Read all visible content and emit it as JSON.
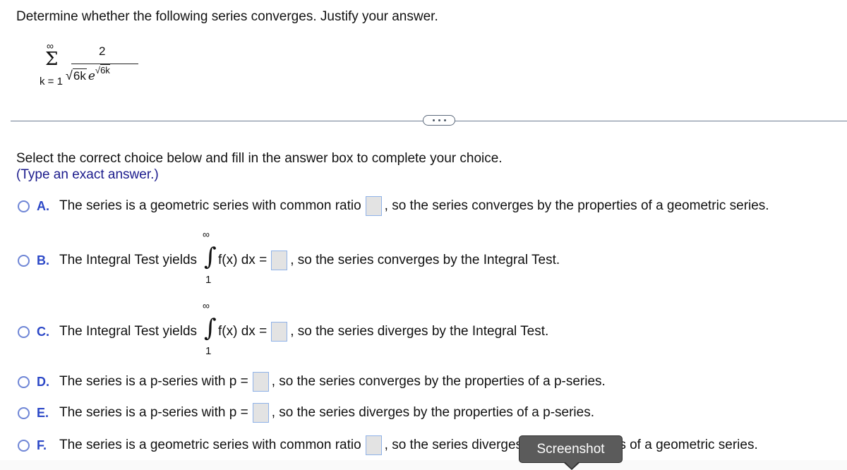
{
  "question": {
    "prompt": "Determine whether the following series converges. Justify your answer.",
    "series": {
      "upper_limit": "∞",
      "lower_limit": "k = 1",
      "sigma": "Σ",
      "numerator": "2",
      "denominator_radicand": "6k",
      "denominator_base": "e",
      "denominator_exponent_radicand": "6k"
    }
  },
  "more_button": {
    "icon": "ellipsis-icon"
  },
  "instructions": {
    "main": "Select the correct choice below and fill in the answer box to complete your choice.",
    "hint": "(Type an exact answer.)"
  },
  "choices": [
    {
      "letter": "A.",
      "before": "The series is a geometric series with common ratio",
      "after": ", so the series converges by the properties of a geometric series.",
      "answer": ""
    },
    {
      "letter": "B.",
      "before": "The Integral Test yields",
      "integral_upper": "∞",
      "integral_lower": "1",
      "integral_symbol": "∫",
      "integrand": "f(x) dx =",
      "after": ", so the series converges by the Integral Test.",
      "answer": ""
    },
    {
      "letter": "C.",
      "before": "The Integral Test yields",
      "integral_upper": "∞",
      "integral_lower": "1",
      "integral_symbol": "∫",
      "integrand": "f(x) dx =",
      "after": ", so the series diverges by the Integral Test.",
      "answer": ""
    },
    {
      "letter": "D.",
      "before": "The series is a p-series with p =",
      "after": ", so the series converges by the properties of a p-series.",
      "answer": ""
    },
    {
      "letter": "E.",
      "before": "The series is a p-series with p =",
      "after": ", so the series diverges by the properties of a p-series.",
      "answer": ""
    },
    {
      "letter": "F.",
      "before": "The series is a geometric series with common ratio",
      "after": ", so the series diverges by the properties of a geometric series.",
      "answer": ""
    }
  ],
  "tooltip": {
    "label": "Screenshot"
  },
  "colors": {
    "letter": "#2c48c7",
    "radio_border": "#6f86d6",
    "hint": "#1a1a8c",
    "answer_box_fill": "#e3e3e3",
    "answer_box_border": "#8fb2e8",
    "tooltip_bg": "#5b5b5b"
  }
}
